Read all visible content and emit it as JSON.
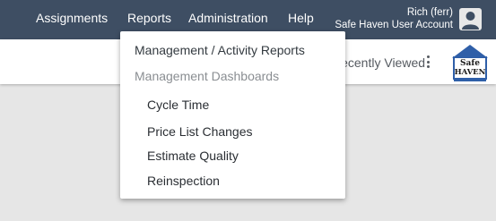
{
  "nav": {
    "assignments": "Assignments",
    "reports": "Reports",
    "administration": "Administration",
    "help": "Help"
  },
  "user": {
    "name": "Rich (ferr)",
    "account": "Safe Haven User Account",
    "avatar_icon": "user-avatar-icon"
  },
  "subbar": {
    "recently_viewed": "Recently Viewed",
    "menu_icon": "kebab-menu-icon"
  },
  "logo": {
    "line1": "Safe",
    "line2": "HAVEN"
  },
  "reports_menu": {
    "header": "Management / Activity Reports",
    "section": "Management Dashboards",
    "items": [
      "Cycle Time",
      "Price List Changes",
      "Estimate Quality",
      "Reinspection"
    ]
  },
  "colors": {
    "navbar": "#3e4e63",
    "background": "#e6e6e6",
    "logo_blue": "#2f5fa8"
  }
}
